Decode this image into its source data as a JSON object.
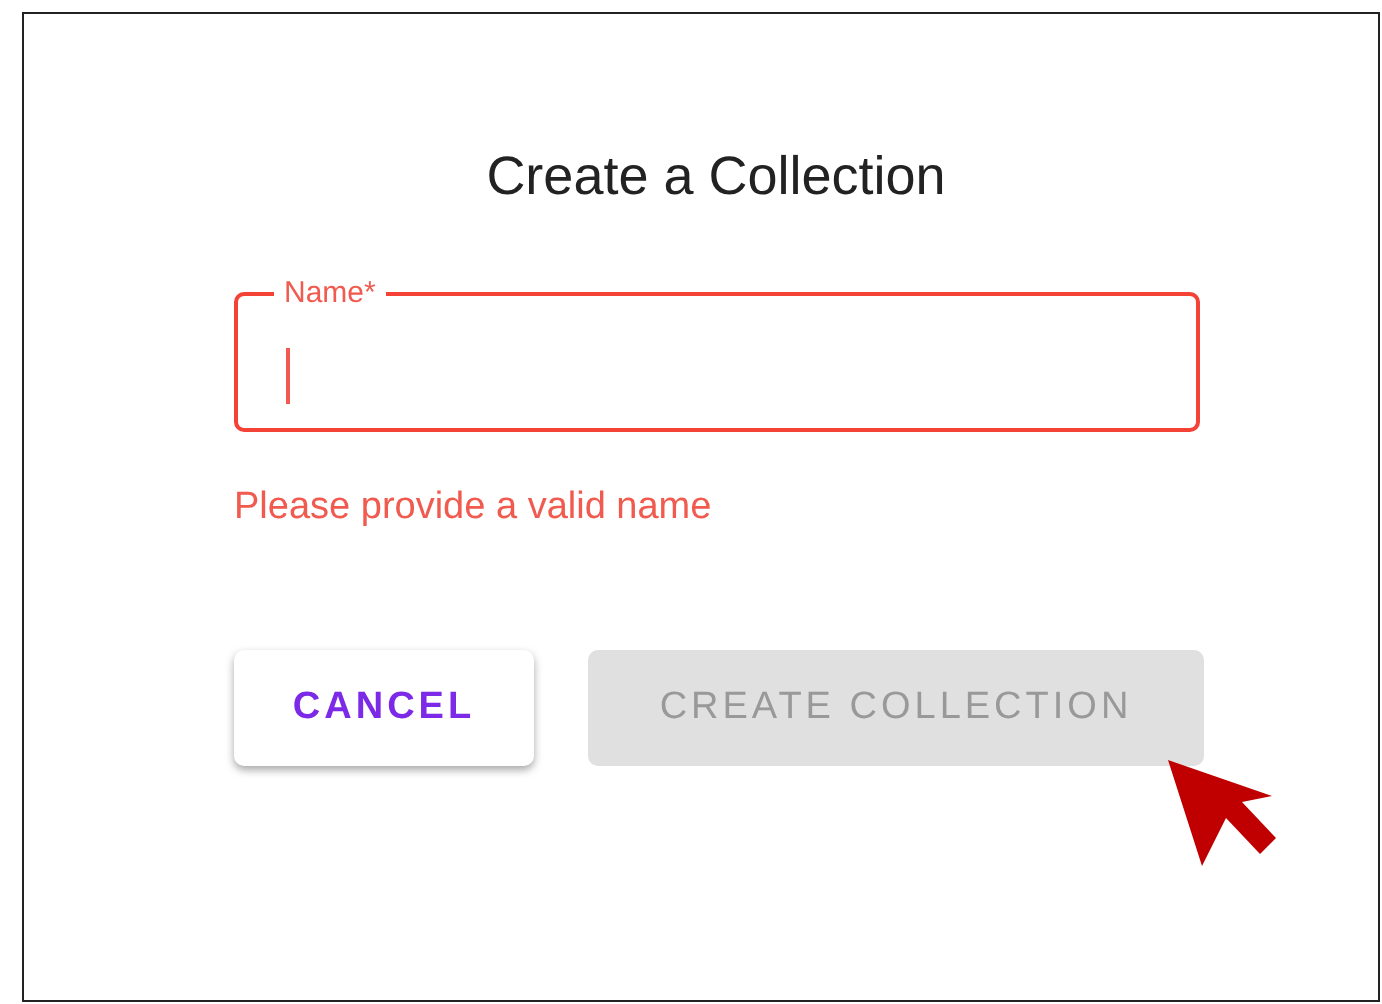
{
  "dialog": {
    "title": "Create a Collection",
    "field": {
      "label": "Name*",
      "error": true,
      "focused": true
    },
    "helper_text": "Please provide a valid name",
    "buttons": [
      {
        "label": "CANCEL",
        "disabled": false
      },
      {
        "label": "CREATE COLLECTION",
        "disabled": true
      }
    ]
  }
}
